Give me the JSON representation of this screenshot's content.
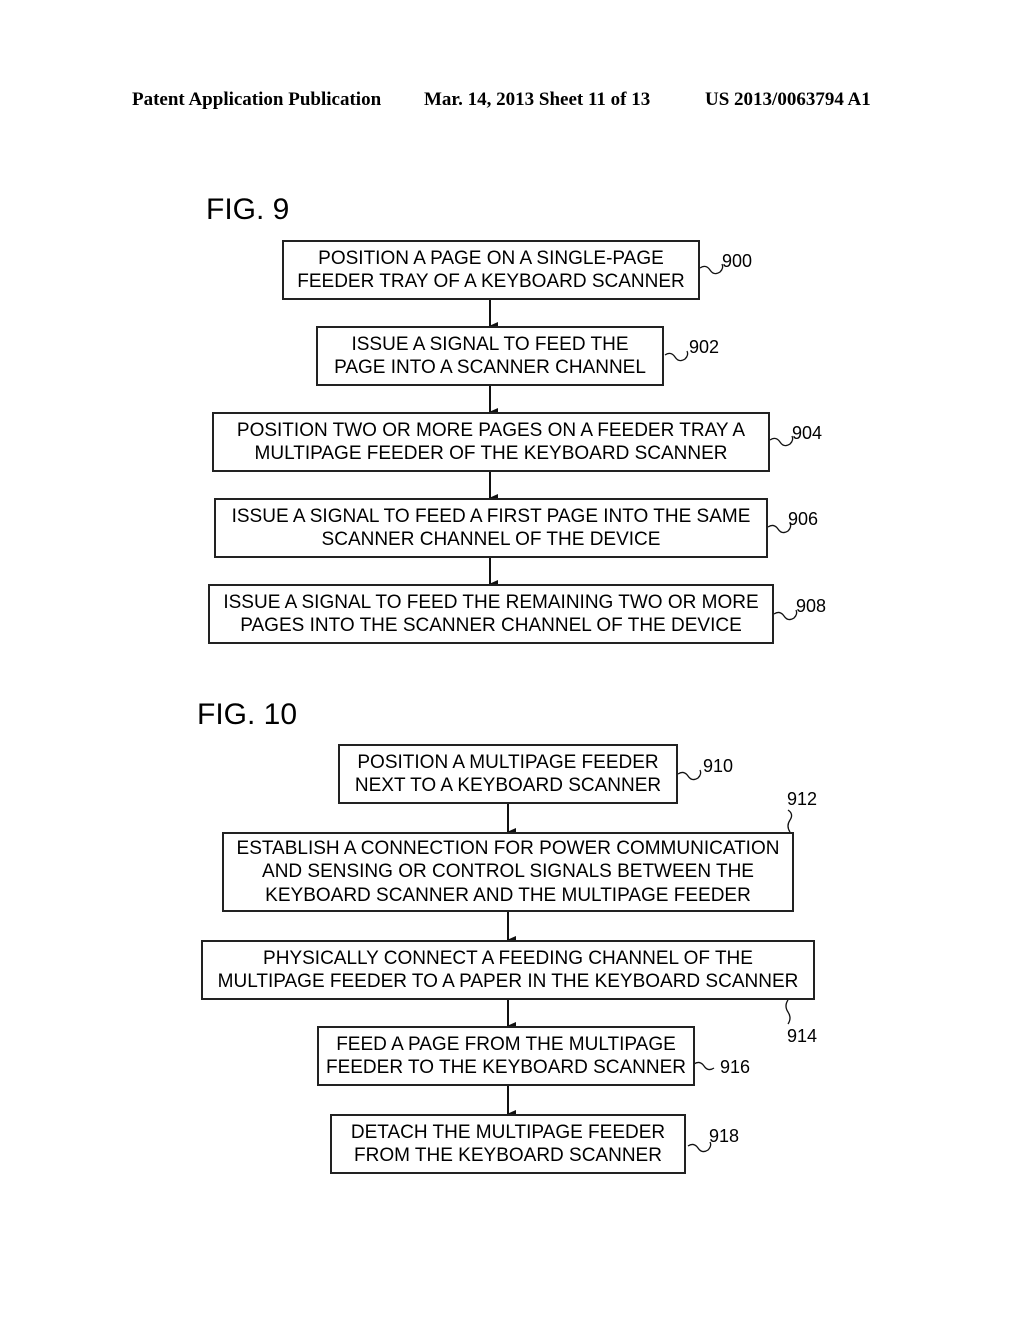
{
  "header": {
    "left": "Patent Application Publication",
    "date_sheet": "Mar. 14, 2013  Sheet 11 of 13",
    "pub_number": "US 2013/0063794 A1"
  },
  "fig9": {
    "title": "FIG. 9",
    "steps": [
      {
        "ref": "900",
        "lines": [
          "POSITION A PAGE ON A SINGLE-PAGE",
          "FEEDER TRAY OF A KEYBOARD SCANNER"
        ]
      },
      {
        "ref": "902",
        "lines": [
          "ISSUE A SIGNAL TO FEED THE",
          "PAGE INTO A SCANNER CHANNEL"
        ]
      },
      {
        "ref": "904",
        "lines": [
          "POSITION TWO OR MORE PAGES ON A FEEDER TRAY A",
          "MULTIPAGE FEEDER OF THE KEYBOARD SCANNER"
        ]
      },
      {
        "ref": "906",
        "lines": [
          "ISSUE A SIGNAL TO FEED A FIRST PAGE INTO THE SAME",
          "SCANNER CHANNEL OF THE DEVICE"
        ]
      },
      {
        "ref": "908",
        "lines": [
          "ISSUE A SIGNAL TO FEED THE REMAINING TWO OR MORE",
          "PAGES INTO THE SCANNER CHANNEL OF THE DEVICE"
        ]
      }
    ]
  },
  "fig10": {
    "title": "FIG. 10",
    "steps": [
      {
        "ref": "910",
        "lines": [
          "POSITION A MULTIPAGE FEEDER",
          "NEXT TO A KEYBOARD SCANNER"
        ]
      },
      {
        "ref": "912",
        "lines": [
          "ESTABLISH A CONNECTION FOR POWER COMMUNICATION",
          "AND SENSING OR CONTROL SIGNALS BETWEEN THE",
          "KEYBOARD SCANNER AND THE MULTIPAGE FEEDER"
        ]
      },
      {
        "ref": "914",
        "lines": [
          "PHYSICALLY CONNECT A FEEDING CHANNEL OF THE",
          "MULTIPAGE FEEDER TO A PAPER IN THE KEYBOARD SCANNER"
        ]
      },
      {
        "ref": "916",
        "lines": [
          "FEED A PAGE FROM THE MULTIPAGE",
          "FEEDER TO THE KEYBOARD SCANNER"
        ]
      },
      {
        "ref": "918",
        "lines": [
          "DETACH THE MULTIPAGE FEEDER",
          "FROM THE KEYBOARD SCANNER"
        ]
      }
    ]
  }
}
